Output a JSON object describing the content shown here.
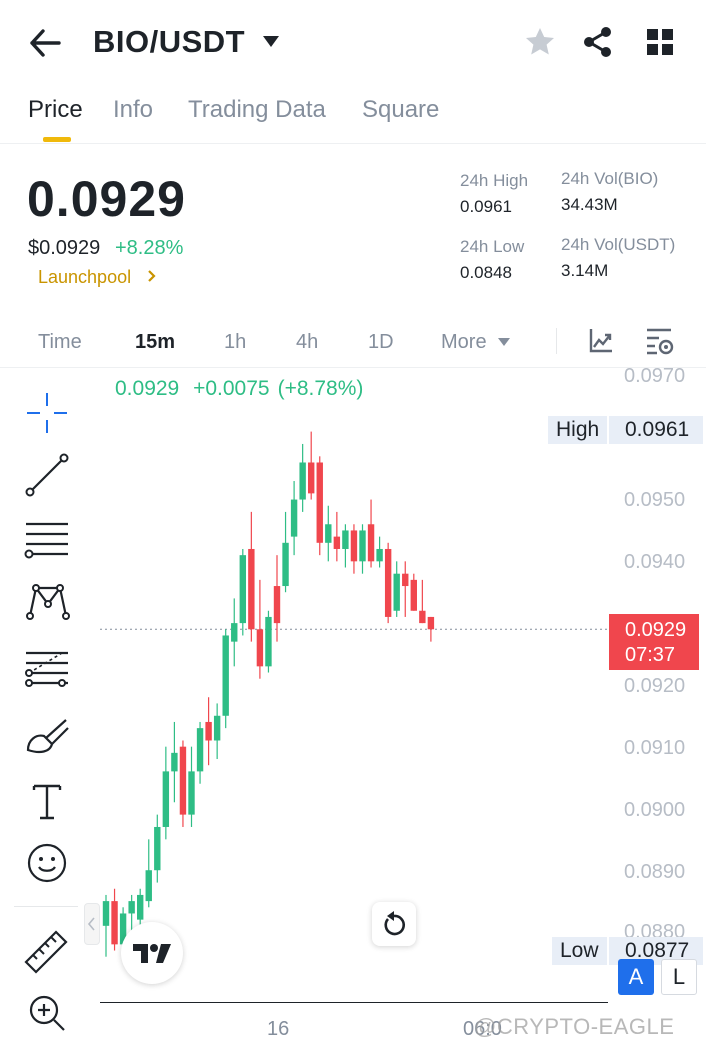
{
  "header": {
    "pair": "BIO/USDT"
  },
  "tabs": [
    {
      "label": "Price",
      "active": true
    },
    {
      "label": "Info",
      "active": false
    },
    {
      "label": "Trading Data",
      "active": false
    },
    {
      "label": "Square",
      "active": false
    }
  ],
  "summary": {
    "last_price": "0.0929",
    "usd_price": "$0.0929",
    "change_pct": "+8.28%",
    "tag": "Launchpool",
    "stats": {
      "high_label": "24h High",
      "high_value": "0.0961",
      "low_label": "24h Low",
      "low_value": "0.0848",
      "vol_base_label": "24h Vol(BIO)",
      "vol_base_value": "34.43M",
      "vol_quote_label": "24h Vol(USDT)",
      "vol_quote_value": "3.14M"
    }
  },
  "intervals": [
    {
      "label": "Time",
      "active": false
    },
    {
      "label": "15m",
      "active": true
    },
    {
      "label": "1h",
      "active": false
    },
    {
      "label": "4h",
      "active": false
    },
    {
      "label": "1D",
      "active": false
    },
    {
      "label": "More",
      "active": false
    }
  ],
  "toolbar_icons": [
    "crosshair-icon",
    "trend-line-icon",
    "horizontal-lines-icon",
    "pattern-icon",
    "fib-icon",
    "brush-icon",
    "text-icon",
    "emoji-icon",
    "ruler-icon",
    "zoom-in-icon"
  ],
  "chart": {
    "ohlc_close": "0.0929",
    "ohlc_change": "+0.0075",
    "ohlc_change_pct": "(+8.78%)",
    "y_axis_ticks": [
      "0.0970",
      "0.0950",
      "0.0940",
      "0.0920",
      "0.0910",
      "0.0900",
      "0.0890",
      "0.0880"
    ],
    "high_label": "High",
    "high_value": "0.0961",
    "low_label": "Low",
    "low_value": "0.0877",
    "current_price": "0.0929",
    "countdown": "07:37",
    "x_label": "16",
    "x_label_2": "06:0",
    "scale_auto": "A",
    "scale_log": "L",
    "watermark": "@CRYPTO-EAGLE",
    "colors": {
      "up": "#2ebd85",
      "down": "#f0464d",
      "accent": "#f0b90b"
    }
  },
  "chart_data": {
    "type": "candlestick",
    "interval": "15m",
    "ylim": [
      0.0875,
      0.0972
    ],
    "candles": [
      {
        "o": 0.0881,
        "h": 0.0886,
        "l": 0.0876,
        "c": 0.0885
      },
      {
        "o": 0.0885,
        "h": 0.0887,
        "l": 0.0877,
        "c": 0.0878
      },
      {
        "o": 0.0878,
        "h": 0.0884,
        "l": 0.0877,
        "c": 0.0883
      },
      {
        "o": 0.0883,
        "h": 0.0886,
        "l": 0.088,
        "c": 0.0885
      },
      {
        "o": 0.0882,
        "h": 0.0887,
        "l": 0.0879,
        "c": 0.0886
      },
      {
        "o": 0.0885,
        "h": 0.0895,
        "l": 0.0884,
        "c": 0.089
      },
      {
        "o": 0.089,
        "h": 0.0899,
        "l": 0.0888,
        "c": 0.0897
      },
      {
        "o": 0.0897,
        "h": 0.091,
        "l": 0.0895,
        "c": 0.0906
      },
      {
        "o": 0.0906,
        "h": 0.0914,
        "l": 0.0901,
        "c": 0.0909
      },
      {
        "o": 0.091,
        "h": 0.0911,
        "l": 0.0897,
        "c": 0.0899
      },
      {
        "o": 0.0899,
        "h": 0.091,
        "l": 0.0897,
        "c": 0.0906
      },
      {
        "o": 0.0906,
        "h": 0.0914,
        "l": 0.0904,
        "c": 0.0913
      },
      {
        "o": 0.0914,
        "h": 0.0918,
        "l": 0.0907,
        "c": 0.0911
      },
      {
        "o": 0.0911,
        "h": 0.0917,
        "l": 0.0908,
        "c": 0.0915
      },
      {
        "o": 0.0915,
        "h": 0.0929,
        "l": 0.0913,
        "c": 0.0928
      },
      {
        "o": 0.0927,
        "h": 0.0934,
        "l": 0.0923,
        "c": 0.093
      },
      {
        "o": 0.093,
        "h": 0.0942,
        "l": 0.0928,
        "c": 0.0941
      },
      {
        "o": 0.0942,
        "h": 0.0948,
        "l": 0.0927,
        "c": 0.0929
      },
      {
        "o": 0.0929,
        "h": 0.0937,
        "l": 0.0921,
        "c": 0.0923
      },
      {
        "o": 0.0923,
        "h": 0.0932,
        "l": 0.0922,
        "c": 0.0931
      },
      {
        "o": 0.0936,
        "h": 0.0941,
        "l": 0.0927,
        "c": 0.093
      },
      {
        "o": 0.0936,
        "h": 0.0948,
        "l": 0.0935,
        "c": 0.0943
      },
      {
        "o": 0.0944,
        "h": 0.0953,
        "l": 0.0941,
        "c": 0.095
      },
      {
        "o": 0.095,
        "h": 0.0959,
        "l": 0.0948,
        "c": 0.0956
      },
      {
        "o": 0.0956,
        "h": 0.0961,
        "l": 0.095,
        "c": 0.0951
      },
      {
        "o": 0.0956,
        "h": 0.0957,
        "l": 0.0941,
        "c": 0.0943
      },
      {
        "o": 0.0943,
        "h": 0.0949,
        "l": 0.094,
        "c": 0.0946
      },
      {
        "o": 0.0944,
        "h": 0.0948,
        "l": 0.094,
        "c": 0.0942
      },
      {
        "o": 0.0942,
        "h": 0.0946,
        "l": 0.0939,
        "c": 0.0945
      },
      {
        "o": 0.0945,
        "h": 0.0946,
        "l": 0.0938,
        "c": 0.094
      },
      {
        "o": 0.094,
        "h": 0.0946,
        "l": 0.0938,
        "c": 0.0945
      },
      {
        "o": 0.0946,
        "h": 0.095,
        "l": 0.0939,
        "c": 0.094
      },
      {
        "o": 0.094,
        "h": 0.0944,
        "l": 0.0939,
        "c": 0.0942
      },
      {
        "o": 0.0942,
        "h": 0.0943,
        "l": 0.093,
        "c": 0.0931
      },
      {
        "o": 0.0932,
        "h": 0.094,
        "l": 0.0931,
        "c": 0.0938
      },
      {
        "o": 0.0938,
        "h": 0.094,
        "l": 0.0931,
        "c": 0.0936
      },
      {
        "o": 0.0937,
        "h": 0.0938,
        "l": 0.0932,
        "c": 0.0932
      },
      {
        "o": 0.0932,
        "h": 0.0937,
        "l": 0.093,
        "c": 0.093
      },
      {
        "o": 0.0931,
        "h": 0.0931,
        "l": 0.0927,
        "c": 0.0929
      }
    ]
  }
}
